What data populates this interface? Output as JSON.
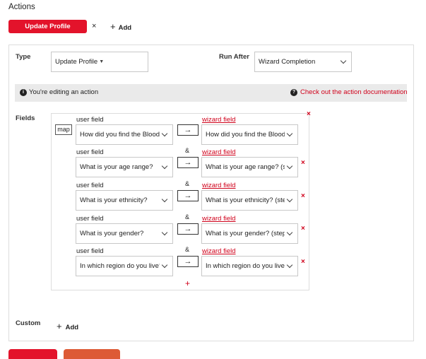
{
  "heading": "Actions",
  "action_tab": {
    "label": "Update Profile (action_1)",
    "close": "×"
  },
  "add_action": {
    "label": "Add"
  },
  "type_label": "Type",
  "type_value": "Update Profile",
  "run_after_label": "Run After",
  "run_after_value": "Wizard Completion",
  "notice": {
    "text": "You're editing an action",
    "doc_link": "Check out the action documentation"
  },
  "fields_label": "Fields",
  "map_button": "map",
  "arrow": "→",
  "rows": [
    {
      "left_label": "user field",
      "left_value": "How did you find the Blood",
      "right_label": "wizard field",
      "right_value": "How did you find the Blood"
    },
    {
      "left_label": "user field",
      "left_value": "What is your age range?",
      "right_label": "wizard field",
      "right_value": "What is your age range? (st"
    },
    {
      "left_label": "user field",
      "left_value": "What is your ethnicity?",
      "right_label": "wizard field",
      "right_value": "What is your ethnicity? (ste"
    },
    {
      "left_label": "user field",
      "left_value": "What is your gender?",
      "right_label": "wizard field",
      "right_value": "What is your gender? (step"
    },
    {
      "left_label": "user field",
      "left_value": "In which region do you live?",
      "right_label": "wizard field",
      "right_value": "In which region do you live?"
    }
  ],
  "connector": "&",
  "remove": "×",
  "add_pair": "+",
  "custom_label": "Custom",
  "add_custom": {
    "label": "Add"
  },
  "colors": {
    "accent": "#e3132b",
    "link": "#d0021b",
    "secondary_button": "#dd5a35"
  },
  "icons": {
    "info": "info-icon",
    "help": "help-icon",
    "close": "close-icon",
    "plus": "plus-icon",
    "chevron": "chevron-down-icon",
    "arrow": "arrow-right-icon"
  }
}
